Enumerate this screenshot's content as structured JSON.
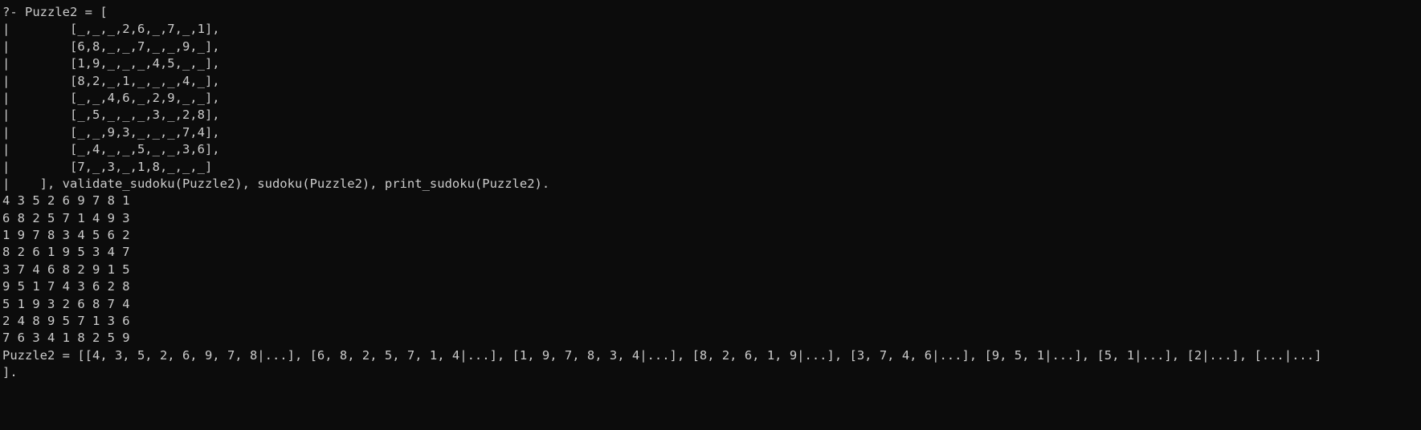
{
  "terminal": {
    "lines": [
      "?- Puzzle2 = [",
      "|        [_,_,_,2,6,_,7,_,1],",
      "|        [6,8,_,_,7,_,_,9,_],",
      "|        [1,9,_,_,_,4,5,_,_],",
      "|        [8,2,_,1,_,_,_,4,_],",
      "|        [_,_,4,6,_,2,9,_,_],",
      "|        [_,5,_,_,_,3,_,2,8],",
      "|        [_,_,9,3,_,_,_,7,4],",
      "|        [_,4,_,_,5,_,_,3,6],",
      "|        [7,_,3,_,1,8,_,_,_]",
      "|    ], validate_sudoku(Puzzle2), sudoku(Puzzle2), print_sudoku(Puzzle2).",
      "4 3 5 2 6 9 7 8 1",
      "6 8 2 5 7 1 4 9 3",
      "1 9 7 8 3 4 5 6 2",
      "8 2 6 1 9 5 3 4 7",
      "3 7 4 6 8 2 9 1 5",
      "9 5 1 7 4 3 6 2 8",
      "5 1 9 3 2 6 8 7 4",
      "2 4 8 9 5 7 1 3 6",
      "7 6 3 4 1 8 2 5 9",
      "Puzzle2 = [[4, 3, 5, 2, 6, 9, 7, 8|...], [6, 8, 2, 5, 7, 1, 4|...], [1, 9, 7, 8, 3, 4|...], [8, 2, 6, 1, 9|...], [3, 7, 4, 6|...], [9, 5, 1|...], [5, 1|...], [2|...], [...|...]",
      "]."
    ]
  }
}
